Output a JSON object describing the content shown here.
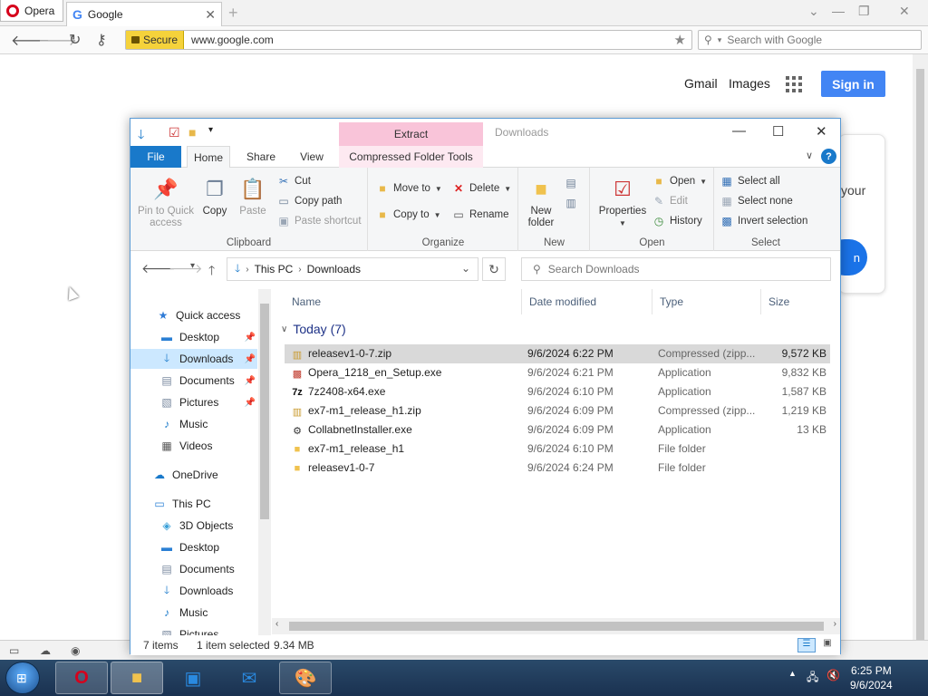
{
  "browser": {
    "menu_label": "Opera",
    "tab_title": "Google",
    "secure_label": "Secure",
    "url": "www.google.com",
    "search_placeholder": "Search with Google"
  },
  "google": {
    "gmail": "Gmail",
    "images": "Images",
    "sign_in": "Sign in",
    "card_text": "your",
    "card_button": "n"
  },
  "explorer": {
    "title": "Downloads",
    "context_tab": "Extract",
    "tabs": [
      "File",
      "Home",
      "Share",
      "View",
      "Compressed Folder Tools"
    ],
    "ribbon": {
      "clipboard": {
        "label": "Clipboard",
        "pin": "Pin to Quick access",
        "copy": "Copy",
        "paste": "Paste",
        "cut": "Cut",
        "copy_path": "Copy path",
        "paste_shortcut": "Paste shortcut"
      },
      "organize": {
        "label": "Organize",
        "move_to": "Move to",
        "copy_to": "Copy to",
        "delete": "Delete",
        "rename": "Rename"
      },
      "new": {
        "label": "New",
        "new_folder": "New folder"
      },
      "open": {
        "label": "Open",
        "properties": "Properties",
        "open": "Open",
        "edit": "Edit",
        "history": "History"
      },
      "select": {
        "label": "Select",
        "select_all": "Select all",
        "select_none": "Select none",
        "invert": "Invert selection"
      }
    },
    "address": {
      "root": "This PC",
      "folder": "Downloads"
    },
    "search_placeholder": "Search Downloads",
    "nav": {
      "quick_access": "Quick access",
      "qa_items": [
        "Desktop",
        "Downloads",
        "Documents",
        "Pictures",
        "Music",
        "Videos"
      ],
      "onedrive": "OneDrive",
      "this_pc": "This PC",
      "pc_items": [
        "3D Objects",
        "Desktop",
        "Documents",
        "Downloads",
        "Music",
        "Pictures"
      ]
    },
    "columns": {
      "name": "Name",
      "date": "Date modified",
      "type": "Type",
      "size": "Size"
    },
    "group": "Today (7)",
    "files": [
      {
        "name": "releasev1-0-7.zip",
        "date": "9/6/2024 6:22 PM",
        "type": "Compressed (zipp...",
        "size": "9,572 KB"
      },
      {
        "name": "Opera_1218_en_Setup.exe",
        "date": "9/6/2024 6:21 PM",
        "type": "Application",
        "size": "9,832 KB"
      },
      {
        "name": "7z2408-x64.exe",
        "date": "9/6/2024 6:10 PM",
        "type": "Application",
        "size": "1,587 KB"
      },
      {
        "name": "ex7-m1_release_h1.zip",
        "date": "9/6/2024 6:09 PM",
        "type": "Compressed (zipp...",
        "size": "1,219 KB"
      },
      {
        "name": "CollabnetInstaller.exe",
        "date": "9/6/2024 6:09 PM",
        "type": "Application",
        "size": "13 KB"
      },
      {
        "name": "ex7-m1_release_h1",
        "date": "9/6/2024 6:10 PM",
        "type": "File folder",
        "size": ""
      },
      {
        "name": "releasev1-0-7",
        "date": "9/6/2024 6:24 PM",
        "type": "File folder",
        "size": ""
      }
    ],
    "status": {
      "count": "7 items",
      "selected": "1 item selected",
      "size": "9.34 MB"
    }
  },
  "taskbar": {
    "time": "6:25 PM",
    "date": "9/6/2024"
  }
}
